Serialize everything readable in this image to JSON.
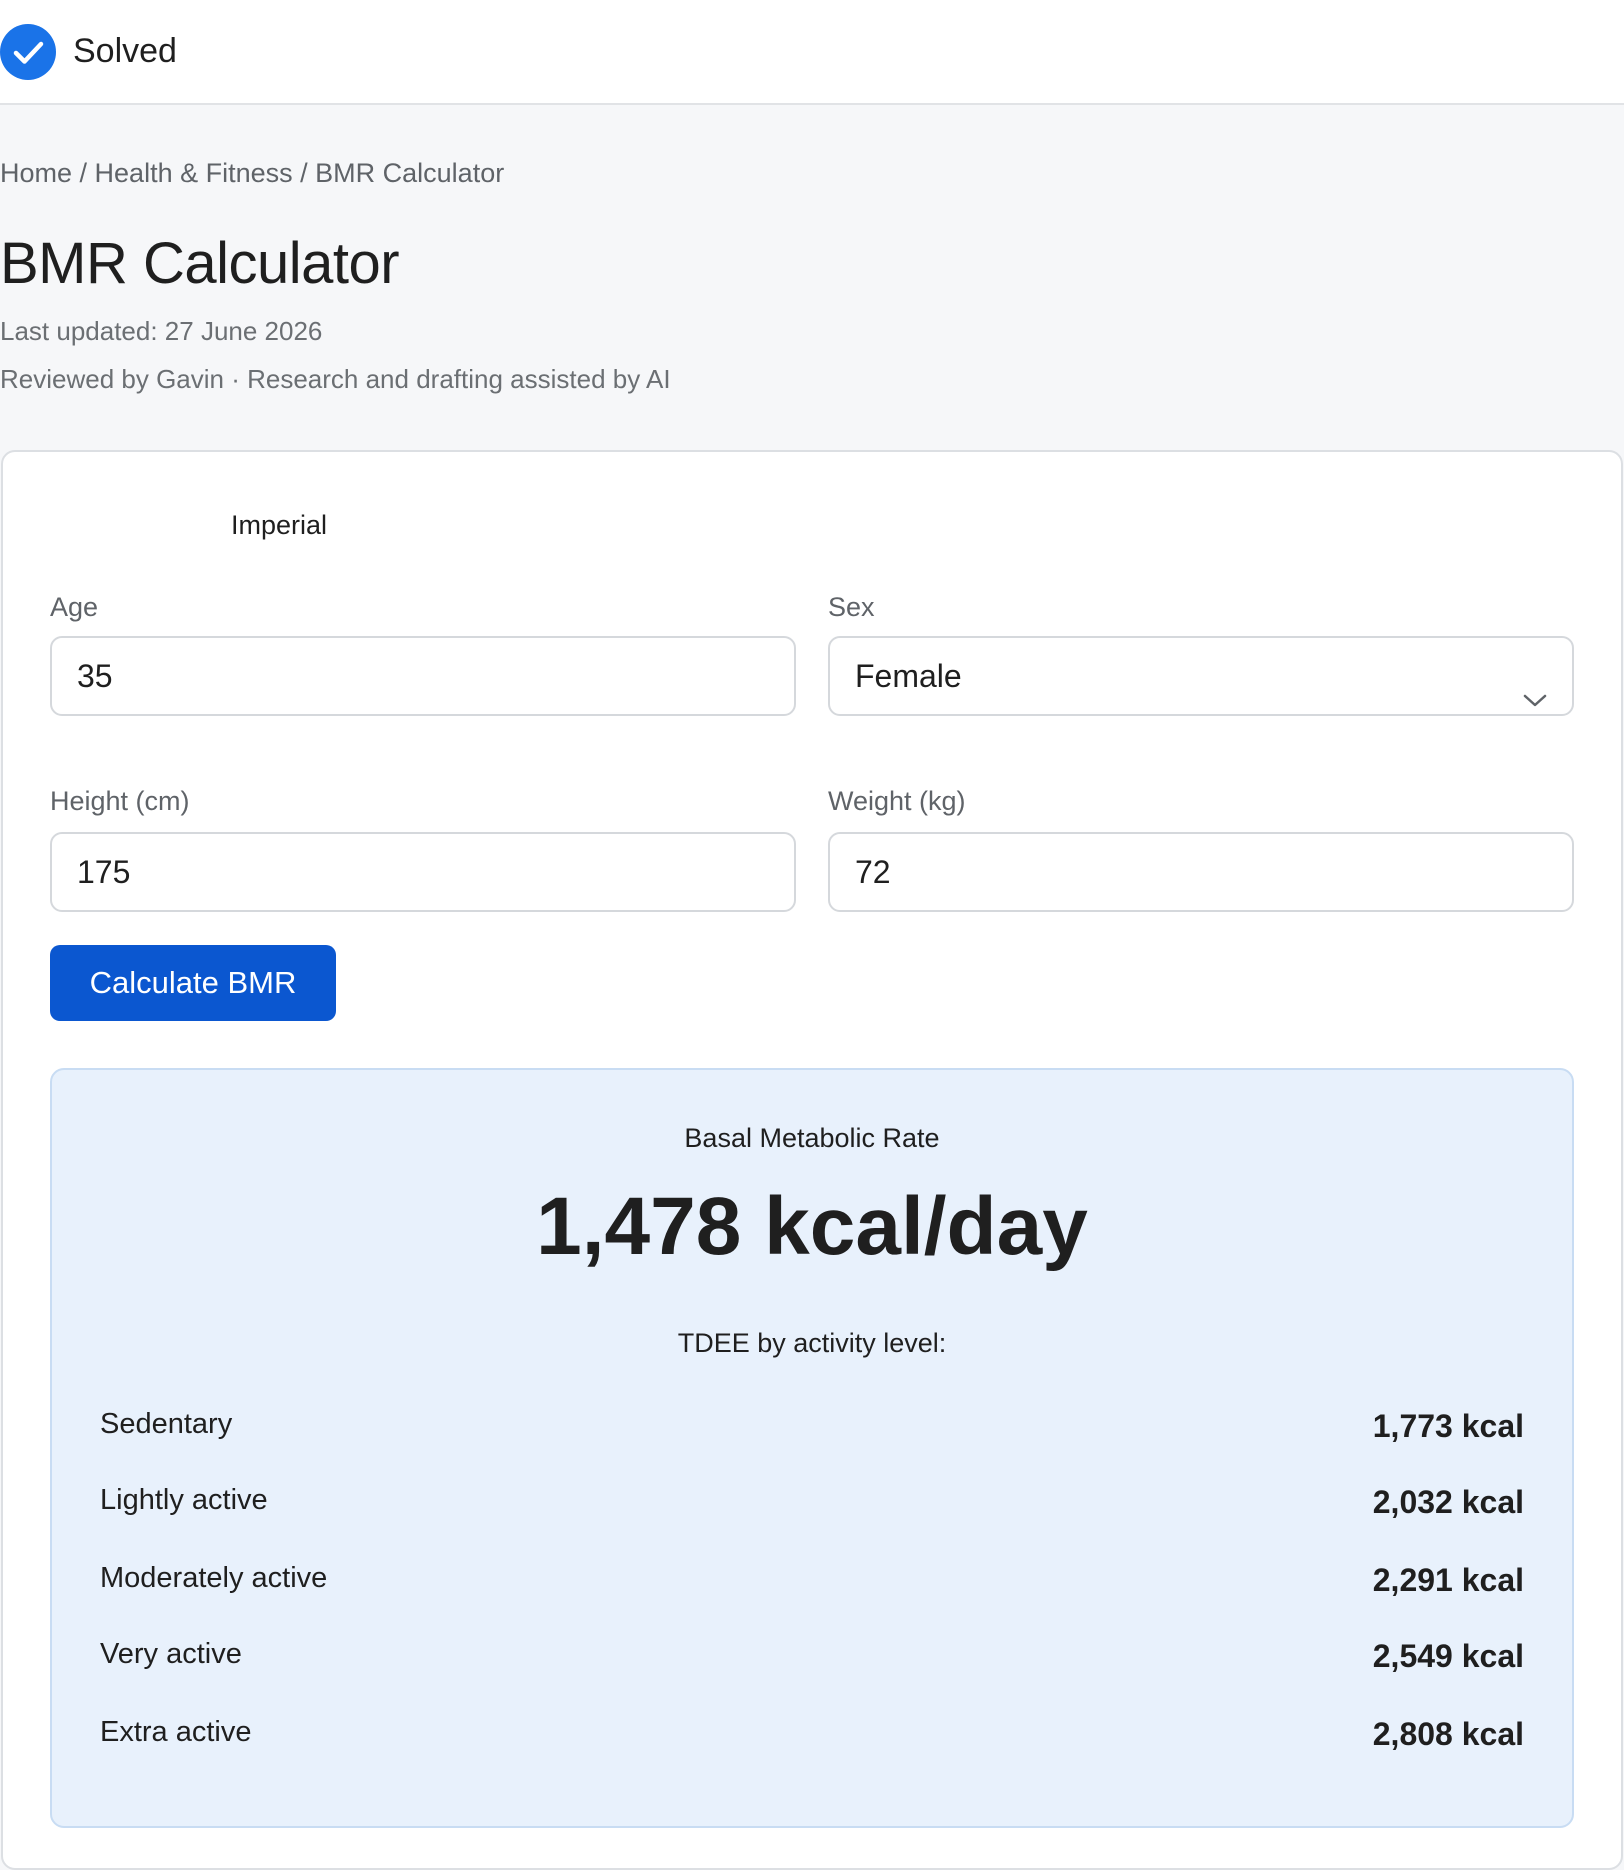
{
  "header": {
    "status_label": "Solved",
    "status_icon": "check-circle-icon",
    "status_color": "#1a73e8"
  },
  "breadcrumb": {
    "items": [
      "Home",
      "Health & Fitness",
      "BMR Calculator"
    ],
    "separator": " / "
  },
  "page": {
    "title": "BMR Calculator",
    "last_updated": "Last updated: 27 June 2026",
    "reviewed": "Reviewed by Gavin · Research and drafting assisted by AI"
  },
  "form": {
    "unit_option": "Imperial",
    "age": {
      "label": "Age",
      "value": "35"
    },
    "sex": {
      "label": "Sex",
      "value": "Female"
    },
    "height": {
      "label": "Height (cm)",
      "value": "175"
    },
    "weight": {
      "label": "Weight (kg)",
      "value": "72"
    },
    "submit_label": "Calculate BMR",
    "accent_color": "#0b57d0"
  },
  "result": {
    "label": "Basal Metabolic Rate",
    "value": "1,478 kcal/day",
    "tdee_heading": "TDEE by activity level:",
    "tdee": [
      {
        "name": "Sedentary",
        "value": "1,773 kcal"
      },
      {
        "name": "Lightly active",
        "value": "2,032 kcal"
      },
      {
        "name": "Moderately active",
        "value": "2,291 kcal"
      },
      {
        "name": "Very active",
        "value": "2,549 kcal"
      },
      {
        "name": "Extra active",
        "value": "2,808 kcal"
      }
    ]
  }
}
